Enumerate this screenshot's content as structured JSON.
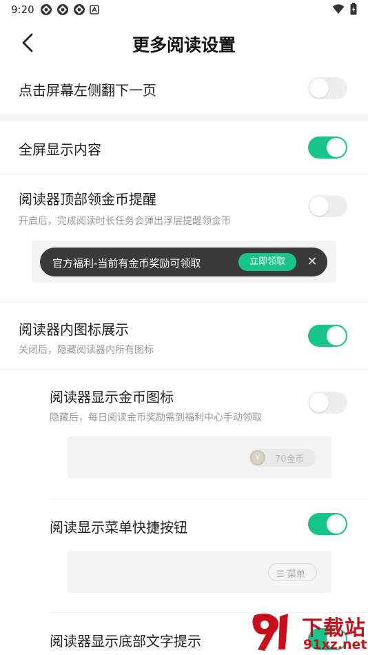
{
  "status_bar": {
    "time": "9:20",
    "notification_icons": [
      "app-icon",
      "app-icon",
      "app-icon",
      "a-icon"
    ],
    "right_icons": [
      "wifi-icon",
      "battery-icon"
    ]
  },
  "header": {
    "title": "更多阅读设置",
    "back_icon": "chevron-left-icon"
  },
  "settings": {
    "tap_left_page": {
      "title": "点击屏幕左侧翻下一页",
      "enabled": false
    },
    "fullscreen": {
      "title": "全屏显示内容",
      "enabled": true
    },
    "top_coin_reminder": {
      "title": "阅读器顶部领金币提醒",
      "subtitle": "开启后，完成阅读时长任务会弹出浮层提醒领金币",
      "enabled": false,
      "preview": {
        "text": "官方福利-当前有金币奖励可领取",
        "button": "立即领取",
        "close": "✕"
      }
    },
    "reader_icons": {
      "title": "阅读器内图标展示",
      "subtitle": "关闭后，隐藏阅读器内所有图标",
      "enabled": true
    },
    "coin_icon": {
      "title": "阅读器显示金币图标",
      "subtitle": "隐藏后，每日阅读金币奖励需到福利中心手动领取",
      "enabled": false,
      "preview": {
        "coin_symbol": "¥",
        "label": "70金币"
      }
    },
    "menu_shortcut": {
      "title": "阅读显示菜单快捷按钮",
      "enabled": true,
      "preview": {
        "label": "☰ 菜单"
      }
    },
    "bottom_text_tip": {
      "title": "阅读器显示底部文字提示",
      "enabled": true
    }
  },
  "watermark": {
    "text_top": "下载站",
    "text_bottom": "91xz.net"
  },
  "colors": {
    "accent": "#17c58a",
    "toggle_off": "#eeeeee",
    "banner_bg": "#3a3a3a",
    "watermark": "#c80f1c"
  }
}
